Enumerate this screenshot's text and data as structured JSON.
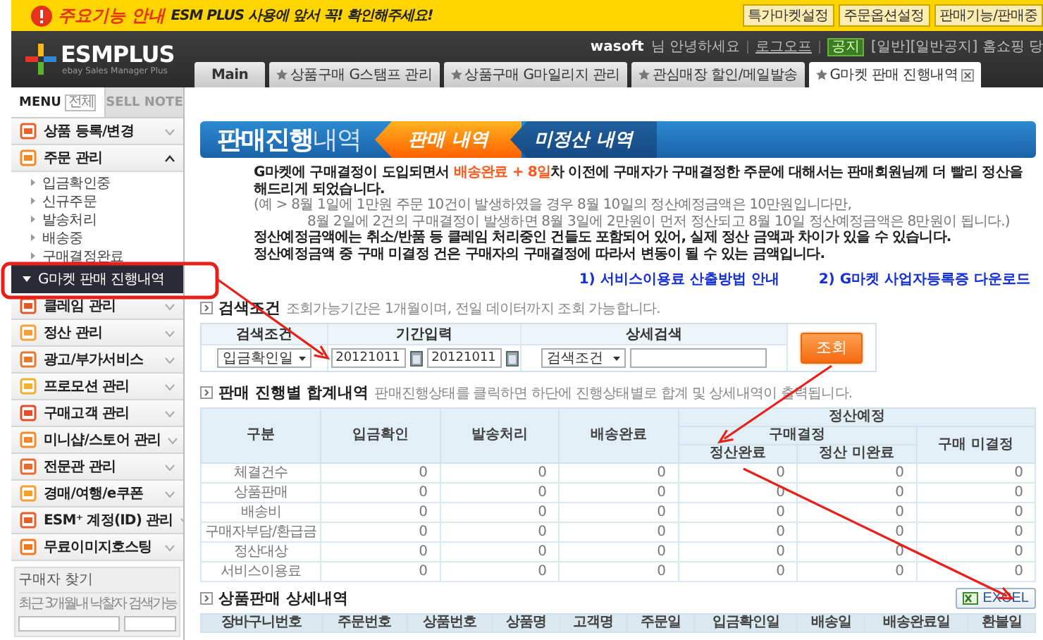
{
  "notice_bar": {
    "label": "주요기능 안내",
    "message": "ESM PLUS 사용에 앞서 꼭! 확인해주세요!",
    "buttons": [
      "특가마켓설정",
      "주문옵션설정",
      "판매기능/판매중"
    ]
  },
  "header": {
    "logo": "ESMPLUS",
    "logo_subtitle": "ebay Sales Manager Plus",
    "user": "wasoft",
    "greeting": "님 안녕하세요",
    "logout": "로그오프",
    "notice_badge": "공지",
    "notice_text": "[일반][일반공지] 홈쇼핑 당"
  },
  "tabs": [
    {
      "label": "Main",
      "starred": false,
      "selected": false,
      "closable": false
    },
    {
      "label": "상품구매 G스탬프 관리",
      "starred": true,
      "selected": false,
      "closable": false
    },
    {
      "label": "상품구매 G마일리지 관리",
      "starred": true,
      "selected": false,
      "closable": false
    },
    {
      "label": "관심매장 할인/메일발송",
      "starred": true,
      "selected": false,
      "closable": false
    },
    {
      "label": "G마켓 판매 진행내역",
      "starred": true,
      "selected": true,
      "closable": true
    }
  ],
  "sidebar": {
    "tabs": [
      {
        "label": "MENU",
        "badge": "전체",
        "selected": true
      },
      {
        "label": "SELL NOTE",
        "selected": false
      }
    ],
    "items": [
      {
        "label": "상품 등록/변경",
        "expanded": false
      },
      {
        "label": "주문 관리",
        "expanded": true,
        "children": [
          {
            "label": "입금확인중",
            "selected": false
          },
          {
            "label": "신규주문",
            "selected": false
          },
          {
            "label": "발송처리",
            "selected": false
          },
          {
            "label": "배송중",
            "selected": false
          },
          {
            "label": "구매결정완료",
            "selected": false
          },
          {
            "label": "G마켓 판매 진행내역",
            "selected": true
          }
        ]
      },
      {
        "label": "클레임 관리",
        "expanded": false
      },
      {
        "label": "정산 관리",
        "expanded": false
      },
      {
        "label": "광고/부가서비스",
        "expanded": false
      },
      {
        "label": "프로모션 관리",
        "expanded": false
      },
      {
        "label": "구매고객 관리",
        "expanded": false
      },
      {
        "label": "미니샵/스토어 관리",
        "expanded": false
      },
      {
        "label": "전문관 관리",
        "expanded": false
      },
      {
        "label": "경매/여행/e쿠폰",
        "expanded": false
      },
      {
        "label": "ESM⁺ 계정(ID) 관리",
        "expanded": false
      },
      {
        "label": "무료이미지호스팅",
        "expanded": false
      }
    ],
    "buyer_search": {
      "title": "구매자 찾기",
      "hint": "최근 3개월내 낙찰자 검색가능"
    }
  },
  "content": {
    "title": "**판매진행**내역",
    "view_tabs": [
      {
        "label": "판매 내역",
        "selected": true
      },
      {
        "label": "미정산 내역",
        "selected": false
      }
    ],
    "notice": [
      {
        "kind": "emphasis",
        "parts": [
          {
            "text": "G마켓에 구매결정이 도입되면서 ",
            "highlight": false
          },
          {
            "text": "배송완료 + 8일",
            "highlight": true
          },
          {
            "text": "차 이전에 구매자가 구매결정한 주문에 대해서는 판매회원님께 더 빨리 정산을 해드리게 되었습니다.",
            "highlight": false
          }
        ]
      },
      {
        "kind": "example",
        "parts": [
          {
            "text": "(예 > 8월 1일에 1만원 주문 10건이 발생하였을 경우 8월 10일의 정산예정금액은 10만원입니다만,",
            "highlight": false
          }
        ]
      },
      {
        "kind": "continuation",
        "parts": [
          {
            "text": "8월 2일에 2건의 구매결정이 발생하면 8월 3일에 2만원이 먼저 정산되고 8월 10일 정산예정금액은 8만원이 됩니다.)",
            "highlight": false
          }
        ]
      },
      {
        "kind": "emphasis",
        "parts": [
          {
            "text": "정산예정금액에는 취소/반품 등 클레임 처리중인 건들도 포함되어 있어, 실제 정산 금액과 차이가 있을 수 있습니다.",
            "highlight": false
          }
        ]
      },
      {
        "kind": "emphasis",
        "parts": [
          {
            "text": "정산예정금액 중 구매 미결정 건은 구매자의 구매결정에 따라서 변동이 될 수 있는 금액입니다.",
            "highlight": false
          }
        ]
      }
    ],
    "links": [
      "1) 서비스이용료 산출방법 안내",
      "2) G마켓 사업자등록증 다운로드"
    ],
    "search": {
      "title": "검색조건",
      "hint": "조회가능기간은 1개월이며, 전일 데이터까지 조회 가능합니다.",
      "columns": [
        "검색조건",
        "기간입력",
        "상세검색"
      ],
      "date_type": "입금확인일",
      "date_from": "20121011",
      "date_to": "20121011",
      "detail_type": "검색조건",
      "button": "조회"
    },
    "summary": {
      "title": "판매 진행별 합계내역",
      "hint": "판매진행상태를 클릭하면 하단에 진행상태별로 합계 및 상세내역이 출력됩니다.",
      "header": {
        "category": "구분",
        "columns": [
          "입금확인",
          "발송처리",
          "배송완료"
        ],
        "group": "정산예정",
        "subgroup": "구매결정",
        "subcolumns": [
          "정산완료",
          "정산 미완료"
        ],
        "undecided": "구매 미결정"
      },
      "rows": [
        {
          "label": "체결건수",
          "values": [
            "0",
            "0",
            "0",
            "0",
            "0",
            "0"
          ]
        },
        {
          "label": "상품판매",
          "values": [
            "0",
            "0",
            "0",
            "0",
            "0",
            "0"
          ]
        },
        {
          "label": "배송비",
          "values": [
            "0",
            "0",
            "0",
            "0",
            "0",
            "0"
          ]
        },
        {
          "label": "구매자부담/환급금",
          "values": [
            "0",
            "0",
            "0",
            "0",
            "0",
            "0"
          ]
        },
        {
          "label": "정산대상",
          "values": [
            "0",
            "0",
            "0",
            "0",
            "0",
            "0"
          ]
        },
        {
          "label": "서비스이용료",
          "values": [
            "0",
            "0",
            "0",
            "0",
            "0",
            "0"
          ]
        }
      ]
    },
    "detail": {
      "title": "상품판매 상세내역",
      "excel_button": "EXCEL",
      "columns": [
        "장바구니번호",
        "주문번호",
        "상품번호",
        "상품명",
        "고객명",
        "주문일",
        "입금확인일",
        "배송일",
        "배송완료일",
        "환불일"
      ]
    }
  }
}
